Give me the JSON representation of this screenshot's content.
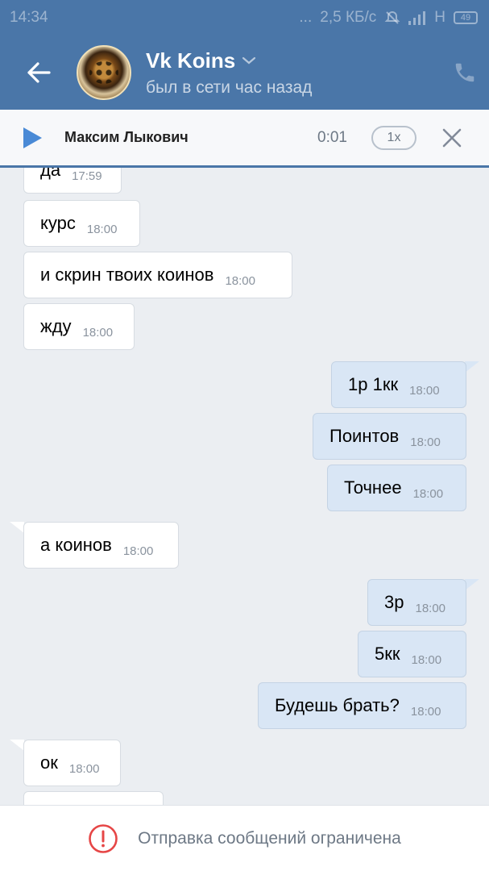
{
  "status_bar": {
    "time": "14:34",
    "dots": "...",
    "network_speed": "2,5 КБ/с",
    "network_type": "H",
    "battery": "49"
  },
  "header": {
    "contact_name": "Vk Koins",
    "status": "был в сети час назад",
    "icons": [
      "back-arrow-icon",
      "chevron-down-icon",
      "phone-icon"
    ]
  },
  "player": {
    "artist": "Максим Лыкович",
    "time": "0:01",
    "speed": "1x",
    "icons": [
      "play-icon",
      "close-icon"
    ]
  },
  "messages": [
    {
      "direction": "in",
      "text": "да",
      "time": "17:59"
    },
    {
      "direction": "in",
      "text": "курс",
      "time": "18:00"
    },
    {
      "direction": "in",
      "text": "и скрин твоих коинов",
      "time": "18:00"
    },
    {
      "direction": "in",
      "text": "жду",
      "time": "18:00"
    },
    {
      "direction": "out",
      "text": "1р 1кк",
      "time": "18:00"
    },
    {
      "direction": "out",
      "text": "Поинтов",
      "time": "18:00"
    },
    {
      "direction": "out",
      "text": "Точнее",
      "time": "18:00"
    },
    {
      "direction": "in",
      "text": "а коинов",
      "time": "18:00"
    },
    {
      "direction": "out",
      "text": "3р",
      "time": "18:00"
    },
    {
      "direction": "out",
      "text": "5кк",
      "time": "18:00"
    },
    {
      "direction": "out",
      "text": "Будешь брать?",
      "time": "18:00"
    },
    {
      "direction": "in",
      "text": "ок",
      "time": "18:00"
    },
    {
      "direction": "in",
      "text": "",
      "time": ""
    }
  ],
  "footer": {
    "notice": "Отправка сообщений ограничена",
    "icon": "alert-circle-icon",
    "alert_color": "#e64646"
  },
  "colors": {
    "header": "#4a76a8",
    "background": "#ebeef2",
    "incoming_bubble": "#ffffff",
    "outgoing_bubble": "#d9e6f5"
  }
}
